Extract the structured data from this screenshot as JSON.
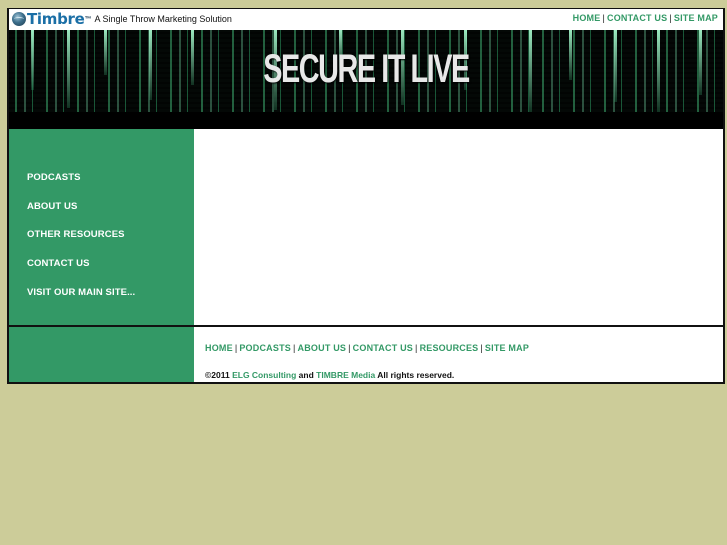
{
  "header": {
    "logo_text": "Timbre",
    "logo_tm": "™",
    "tagline": "A Single Throw Marketing Solution",
    "top_links": [
      {
        "label": "HOME"
      },
      {
        "label": "CONTACT US"
      },
      {
        "label": "SITE MAP"
      }
    ],
    "separator": "|"
  },
  "banner": {
    "title": "SECURE IT LIVE"
  },
  "sidebar": {
    "items": [
      {
        "label": "PODCASTS"
      },
      {
        "label": "ABOUT US"
      },
      {
        "label": "OTHER RESOURCES"
      },
      {
        "label": "CONTACT US"
      },
      {
        "label": "VISIT OUR MAIN SITE..."
      }
    ]
  },
  "footer": {
    "links": [
      {
        "label": "HOME"
      },
      {
        "label": "PODCASTS"
      },
      {
        "label": "ABOUT US"
      },
      {
        "label": "CONTACT US"
      },
      {
        "label": "RESOURCES"
      },
      {
        "label": "SITE MAP"
      }
    ],
    "separator": "|",
    "copyright_prefix": "©2011",
    "company1": "ELG Consulting",
    "conjunction": "and",
    "company2": "TIMBRE Media",
    "rights": "All rights reserved."
  },
  "colors": {
    "page_background": "#cccc99",
    "brand_green": "#339966",
    "logo_blue": "#1b6fa6"
  }
}
